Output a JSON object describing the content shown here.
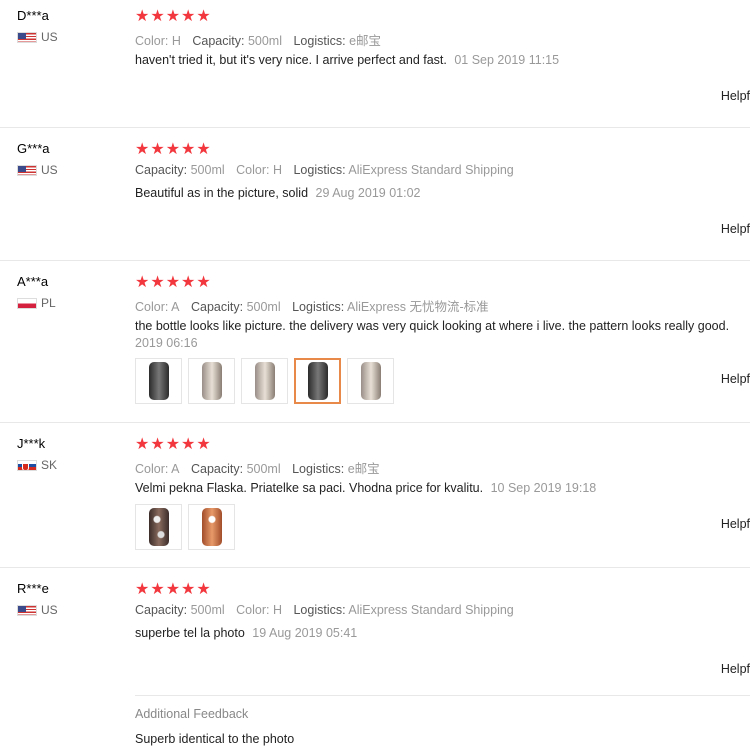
{
  "reviews": [
    {
      "user": "D***a",
      "country": "US",
      "stars": "★★★★★",
      "attrs": [
        [
          "Color:",
          "H"
        ],
        [
          "Capacity:",
          "500ml"
        ],
        [
          "Logistics:",
          "e邮宝"
        ]
      ],
      "text": "haven't tried it, but it's very nice. I arrive perfect and fast.",
      "date": "01 Sep 2019 11:15",
      "helpful": "Helpf"
    },
    {
      "user": "G***a",
      "country": "US",
      "stars": "★★★★★",
      "attrs": [
        [
          "Capacity:",
          "500ml"
        ],
        [
          "Color:",
          "H"
        ],
        [
          "Logistics:",
          "AliExpress Standard Shipping"
        ]
      ],
      "text": "Beautiful as in the picture, solid",
      "date": "29 Aug 2019 01:02",
      "helpful": "Helpf"
    },
    {
      "user": "A***a",
      "country": "PL",
      "stars": "★★★★★",
      "attrs": [
        [
          "Color:",
          "A"
        ],
        [
          "Capacity:",
          "500ml"
        ],
        [
          "Logistics:",
          "AliExpress 无忧物流-标准"
        ]
      ],
      "text": "the bottle looks like picture. the delivery was very quick looking at where i live. the pattern looks really good.",
      "date": "2019 06:16",
      "helpful": "Helpf"
    },
    {
      "user": "J***k",
      "country": "SK",
      "stars": "★★★★★",
      "attrs": [
        [
          "Color:",
          "A"
        ],
        [
          "Capacity:",
          "500ml"
        ],
        [
          "Logistics:",
          "e邮宝"
        ]
      ],
      "text": "Velmi pekna Flaska. Priatelke sa paci. Vhodna price for kvalitu.",
      "date": "10 Sep 2019 19:18",
      "helpful": "Helpf"
    },
    {
      "user": "R***e",
      "country": "US",
      "stars": "★★★★★",
      "attrs": [
        [
          "Capacity:",
          "500ml"
        ],
        [
          "Color:",
          "H"
        ],
        [
          "Logistics:",
          "AliExpress Standard Shipping"
        ]
      ],
      "text": "superbe tel la photo",
      "date": "19 Aug 2019 05:41",
      "helpful": "Helpf",
      "additional_title": "Additional Feedback",
      "additional_text": "Superb identical to the photo"
    }
  ],
  "colors": {
    "star": "#f2383e",
    "active_thumb_border": "#e8894a"
  }
}
